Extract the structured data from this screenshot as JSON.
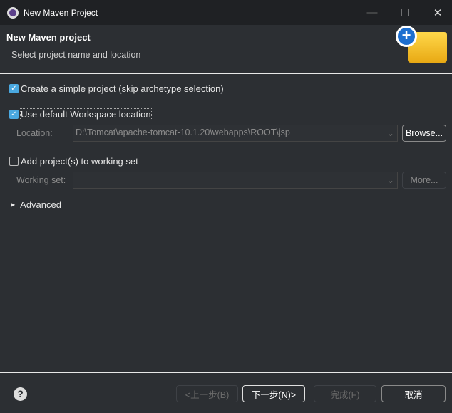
{
  "window": {
    "title": "New Maven Project"
  },
  "header": {
    "title": "New Maven project",
    "subtitle": "Select project name and location"
  },
  "options": {
    "simple_project": {
      "label": "Create a simple project (skip archetype selection)",
      "checked": true
    },
    "default_workspace": {
      "label": "Use default Workspace location",
      "checked": true
    },
    "location_label": "Location:",
    "location_value": "D:\\Tomcat\\apache-tomcat-10.1.20\\webapps\\ROOT\\jsp",
    "browse_label": "Browse...",
    "working_set_check": {
      "label": "Add project(s) to working set",
      "checked": false
    },
    "working_set_label": "Working set:",
    "working_set_value": "",
    "more_label": "More...",
    "advanced_label": "Advanced"
  },
  "footer": {
    "back": "<上一步(B)",
    "next": "下一步(N)>",
    "finish": "完成(F)",
    "cancel": "取消"
  }
}
